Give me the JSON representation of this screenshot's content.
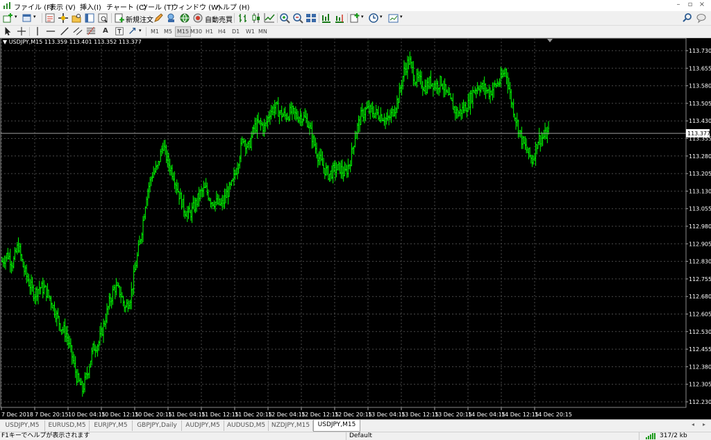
{
  "menu": [
    "ファイル (F)",
    "表示 (V)",
    "挿入(I)",
    "チャート (C)",
    "ツール (T)",
    "ウィンドウ (W)",
    "ヘルプ (H)"
  ],
  "window_controls": {
    "minimize": "–",
    "restore": "▫",
    "close": "×"
  },
  "toolbar": {
    "new_order_label": "新規注文",
    "autotrade_label": "自動売買"
  },
  "timeframes": [
    "M1",
    "M5",
    "M15",
    "M30",
    "H1",
    "H4",
    "D1",
    "W1",
    "MN"
  ],
  "active_timeframe": "M15",
  "chart_header": "USDJPY,M15  113.359 113.401 113.352 113.377",
  "current_price_label": "113.377",
  "colors": {
    "background": "#000000",
    "candles": "#00ff00",
    "grid": "#4a4a4a",
    "axis_text": "#ffffff",
    "price_line": "#a0a0a0"
  },
  "chart_data": {
    "type": "line",
    "symbol": "USDJPY",
    "timeframe": "M15",
    "ylim": [
      112.23,
      113.73
    ],
    "y_ticks": [
      "113.730",
      "113.655",
      "113.580",
      "113.505",
      "113.430",
      "113.355",
      "113.280",
      "113.205",
      "113.130",
      "113.055",
      "112.980",
      "112.905",
      "112.830",
      "112.755",
      "112.680",
      "112.605",
      "112.530",
      "112.455",
      "112.380",
      "112.305",
      "112.230"
    ],
    "x_ticks": [
      "7 Dec 2018",
      "7 Dec 20:15",
      "10 Dec 04:15",
      "10 Dec 12:15",
      "10 Dec 20:15",
      "11 Dec 04:15",
      "11 Dec 12:15",
      "11 Dec 20:15",
      "12 Dec 04:15",
      "12 Dec 12:15",
      "12 Dec 20:15",
      "13 Dec 04:15",
      "13 Dec 12:15",
      "13 Dec 20:15",
      "14 Dec 04:15",
      "14 Dec 12:15",
      "14 Dec 20:15"
    ],
    "last_price": 113.377,
    "price_path": [
      112.83,
      112.86,
      112.82,
      112.9,
      112.8,
      112.74,
      112.69,
      112.72,
      112.71,
      112.67,
      112.61,
      112.55,
      112.52,
      112.43,
      112.33,
      112.28,
      112.36,
      112.46,
      112.48,
      112.56,
      112.65,
      112.72,
      112.7,
      112.63,
      112.68,
      112.82,
      112.95,
      113.12,
      113.2,
      113.23,
      113.33,
      113.25,
      113.2,
      113.12,
      113.05,
      113.03,
      113.07,
      113.12,
      113.14,
      113.09,
      113.08,
      113.07,
      113.12,
      113.16,
      113.25,
      113.36,
      113.31,
      113.4,
      113.42,
      113.4,
      113.47,
      113.49,
      113.46,
      113.45,
      113.47,
      113.45,
      113.45,
      113.43,
      113.35,
      113.28,
      113.23,
      113.2,
      113.22,
      113.23,
      113.2,
      113.26,
      113.38,
      113.45,
      113.48,
      113.47,
      113.46,
      113.45,
      113.43,
      113.47,
      113.53,
      113.64,
      113.69,
      113.61,
      113.6,
      113.57,
      113.6,
      113.58,
      113.6,
      113.54,
      113.5,
      113.46,
      113.48,
      113.5,
      113.56,
      113.58,
      113.57,
      113.55,
      113.58,
      113.6,
      113.65,
      113.52,
      113.43,
      113.35,
      113.3,
      113.26,
      113.35,
      113.36,
      113.38
    ],
    "candle_count": 470
  },
  "tabs": [
    "USDJPY,M5",
    "EURUSD,M5",
    "EURJPY,M5",
    "GBPJPY,Daily",
    "AUDJPY,M5",
    "AUDUSD,M5",
    "NZDJPY,M15",
    "USDJPY,M15"
  ],
  "active_tab": "USDJPY,M15",
  "status": {
    "help": "F1キーでヘルプが表示されます",
    "profile": "Default",
    "traffic": "317/2 kb"
  }
}
